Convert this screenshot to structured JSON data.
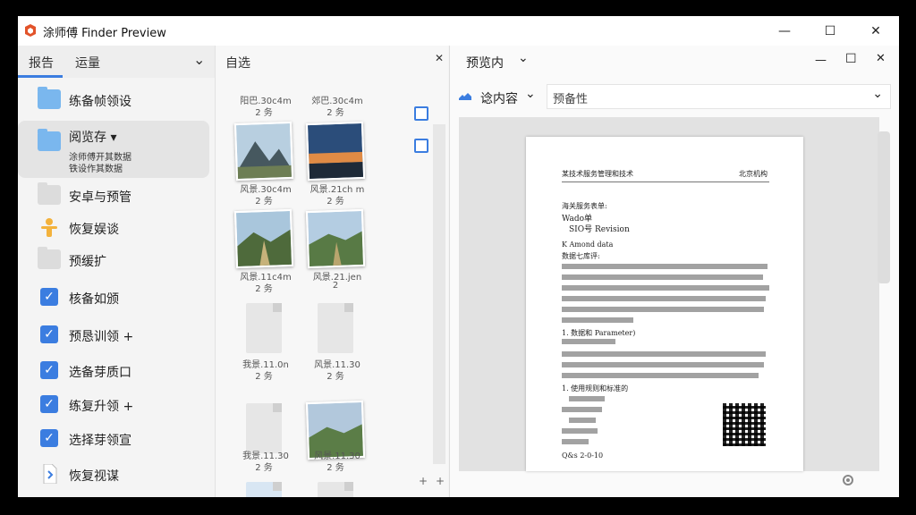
{
  "window": {
    "title": "涂师傅 Finder Preview",
    "controls": {
      "minimize": "—",
      "maximize": "☐",
      "close": "✕"
    }
  },
  "left": {
    "tabs": [
      {
        "label": "报告"
      },
      {
        "label": "运量"
      }
    ],
    "tab_chevron": "⌄",
    "items": [
      {
        "label": "练备帧领设",
        "icon": "folder-icon"
      },
      {
        "label": "阅览存 ▾",
        "icon": "folder-icon",
        "sub": [
          "涂师傅开其数据",
          "铁设作其数据"
        ]
      },
      {
        "label": "安卓与预管",
        "icon": "folder-icon"
      },
      {
        "label": "恢复娱谈",
        "icon": "person-icon"
      },
      {
        "label": "预缓扩",
        "icon": "folder-icon"
      },
      {
        "label": "核备如颁",
        "icon": "checkbox-icon"
      },
      {
        "label": "预恳训领 +",
        "icon": "checkbox-icon"
      },
      {
        "label": "选备芽质口",
        "icon": "checkbox-icon"
      },
      {
        "label": "练复升领 +",
        "icon": "checkbox-icon"
      },
      {
        "label": "选择芽领宣",
        "icon": "checkbox-icon"
      },
      {
        "label": "恢复视谋",
        "icon": "file-icon"
      }
    ]
  },
  "middle": {
    "title": "自选",
    "close": "✕",
    "thumbs": [
      {
        "name": "阳巴.30c4m",
        "size": "2 务"
      },
      {
        "name": "郊巴.30c4m",
        "size": "2 务"
      },
      {
        "name": "风景.30c4m",
        "size": "2 务"
      },
      {
        "name": "风景.21ch m",
        "size": "2 务"
      },
      {
        "name": "风景.11c4m",
        "size": "2 务"
      },
      {
        "name": "风景.21.jen",
        "size": "2"
      },
      {
        "name": "我景.11.0n",
        "size": "2 务"
      },
      {
        "name": "风景.11.30",
        "size": "2 务"
      },
      {
        "name": "我景.11.30",
        "size": "2 务"
      },
      {
        "name": "风景.11.30",
        "size": "2 务"
      }
    ],
    "plus": "+"
  },
  "right": {
    "title": "预览内",
    "chevron": "⌄",
    "toolbar_label": "谂内容",
    "dropdown_text": "预备性",
    "page": {
      "header_left": "某技术服务管理和技术",
      "header_right": "北京机构",
      "block1": [
        "海关服务表单:",
        "Wado单",
        "SIO号 Revision"
      ],
      "body_intro": "K Amond data",
      "section1": "数据七库评:",
      "section2": "1. 数据和 Parameter)",
      "section3": "1. 使用规则和标准的",
      "date": "Q&s 2-0-10"
    }
  },
  "colors": {
    "accent": "#3b7de0",
    "folder": "#7ab7ee"
  }
}
